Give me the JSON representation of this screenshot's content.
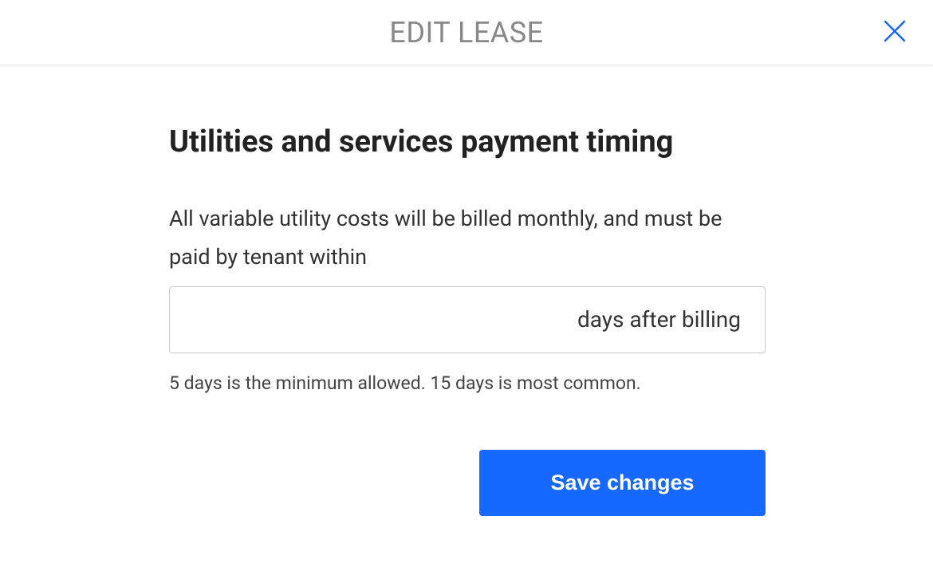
{
  "header": {
    "title": "EDIT LEASE"
  },
  "main": {
    "section_title": "Utilities and services payment timing",
    "description": "All variable utility costs will be billed monthly, and must be paid by tenant within",
    "days_value": "",
    "input_suffix": "days after billing",
    "hint": "5 days is the minimum allowed. 15 days is most common.",
    "save_label": "Save changes"
  },
  "colors": {
    "primary": "#1768ff",
    "header_text": "#888888"
  }
}
